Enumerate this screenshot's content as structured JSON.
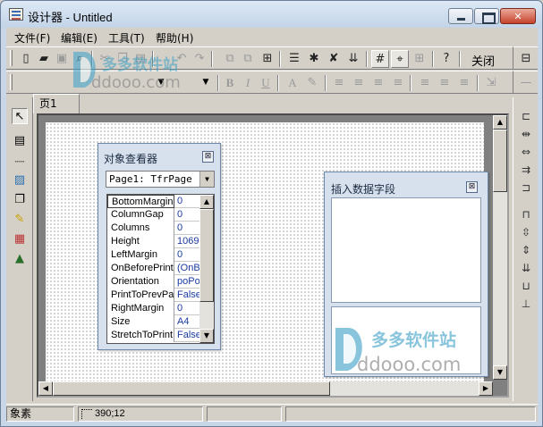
{
  "window": {
    "title": "设计器 - Untitled",
    "controls": {
      "minimize": "",
      "maximize": "",
      "close": "✕"
    }
  },
  "menu": [
    {
      "label": "文件(F)"
    },
    {
      "label": "编辑(E)"
    },
    {
      "label": "工具(T)"
    },
    {
      "label": "帮助(H)"
    }
  ],
  "toolbar": {
    "close_label": "关闭",
    "icons": [
      "new-icon",
      "open-icon",
      "save-icon",
      "preview-icon",
      "cut-icon",
      "copy-icon",
      "paste-icon",
      "undo-icon",
      "redo-icon",
      "bring-front-icon",
      "send-back-icon",
      "group-icon",
      "insert-band-icon",
      "insert-page-icon",
      "delete-page-icon",
      "page-settings-icon",
      "grid-icon",
      "snap-to-grid-icon",
      "align-grid-icon",
      "help-icon"
    ]
  },
  "format_toolbar": {
    "bold": "B",
    "italic": "I",
    "underline": "U",
    "font_color": "A"
  },
  "tabs": [
    {
      "label": "页1"
    }
  ],
  "object_inspector": {
    "title": "对象查看器",
    "selected_object": "Page1: TfrPage",
    "properties": [
      {
        "name": "BottomMargin",
        "value": "0"
      },
      {
        "name": "ColumnGap",
        "value": "0"
      },
      {
        "name": "Columns",
        "value": "0"
      },
      {
        "name": "Height",
        "value": "1069"
      },
      {
        "name": "LeftMargin",
        "value": "0"
      },
      {
        "name": "OnBeforePrint",
        "value": "(OnB"
      },
      {
        "name": "Orientation",
        "value": "poPo"
      },
      {
        "name": "PrintToPrevPa",
        "value": "False"
      },
      {
        "name": "RightMargin",
        "value": "0"
      },
      {
        "name": "Size",
        "value": "A4"
      },
      {
        "name": "StretchToPrint",
        "value": "False"
      }
    ]
  },
  "insert_field_panel": {
    "title": "插入数据字段"
  },
  "statusbar": {
    "unit": "象素",
    "position": "390;12"
  },
  "watermark": {
    "brand": "多多软件站",
    "domain": "ddooo.com"
  },
  "colors": {
    "panel_bg": "#d7e1ee",
    "value_text": "#1a3aa0",
    "window_frame": "#c8d6e8"
  }
}
